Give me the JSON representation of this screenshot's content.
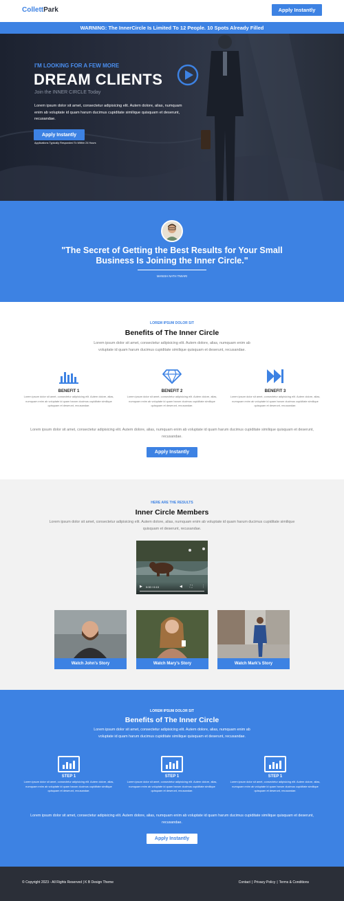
{
  "header": {
    "logo_part1": "Collett",
    "logo_part2": "Park",
    "cta_label": "Apply Instantly"
  },
  "warning_bar": {
    "text": "WARNING: The InnerCircle Is Limited To 12 People. 10 Spots Already Filled"
  },
  "hero": {
    "pretitle": "I'M LOOKING FOR A FEW MORE",
    "title": "DREAM CLIENTS",
    "subtitle": "Join the INNER CIRCLE Today",
    "body": "Lorem ipsum dolor sit amet, consectetur adipisicing elit. Autem dolore, alias, numquam enim ab voluptate id quam harum ducimus cupiditate similique quisquam et deserunt, recusandae.",
    "cta_label": "Apply Instantly",
    "note": "Applications Typically Responded To Within 24 Hours"
  },
  "testimonial": {
    "quote": "\"The Secret of Getting the Best Results for Your Small Business Is Joining the Inner Circle.\"",
    "author": "MANISH NATH TIWARI"
  },
  "benefits": {
    "eyebrow": "LOREM IPSUM DOLOR SIT",
    "title": "Benefits of The Inner Circle",
    "description": "Lorem ipsum dolor sit amet, consectetur adipisicing elit. Autem dolore, alias, numquam enim ab voluptate id quam harum ducimus cupiditate similique quisquam et deserunt, recusandae.",
    "items": [
      {
        "icon": "bar-chart-icon",
        "title": "BENEFIT 1",
        "text": "Lorem ipsum dolor sit amet, consectetur adipisicing elit. Autem dolore, alias, numquam enim ab voluptate id quam harum ducimus cupiditate similique quisquam et deserunt, recusandae."
      },
      {
        "icon": "diamond-icon",
        "title": "BENEFIT 2",
        "text": "Lorem ipsum dolor sit amet, consectetur adipisicing elit. Autem dolore, alias, numquam enim ab voluptate id quam harum ducimus cupiditate similique quisquam et deserunt, recusandae."
      },
      {
        "icon": "fast-forward-icon",
        "title": "BENEFIT 3",
        "text": "Lorem ipsum dolor sit amet, consectetur adipisicing elit. Autem dolore, alias, numquam enim ab voluptate id quam harum ducimus cupiditate similique quisquam et deserunt, recusandae."
      }
    ],
    "footer_text": "Lorem ipsum dolor sit amet, consectetur adipisicing elit. Autem dolore, alias, numquam enim ab voluptate id quam harum ducimus cupiditate similique quisquam et deserunt, recusandae.",
    "cta_label": "Apply Instantly"
  },
  "members": {
    "eyebrow": "HERE ARE THE RESULTS",
    "title": "Inner Circle Members",
    "description": "Lorem ipsum dolor sit amet, consectetur adipisicing elit. Autem dolore, alias, numquam enim ab voluptate id quam harum ducimus cupiditate similique quisquam et deserunt, recusandae.",
    "video": {
      "time": "0:00 / 0:13"
    },
    "stories": [
      {
        "label": "Watch John's Story"
      },
      {
        "label": "Watch Mary's Story"
      },
      {
        "label": "Watch Mark's Story"
      }
    ]
  },
  "steps": {
    "eyebrow": "LOREM IPSUM DOLOR SIT",
    "title": "Benefits of The Inner Circle",
    "description": "Lorem ipsum dolor sit amet, consectetur adipisicing elit. Autem dolore, alias, numquam enim ab voluptate id quam harum ducimus cupiditate similique quisquam et deserunt, recusandae.",
    "items": [
      {
        "title": "STEP 1",
        "text": "Lorem ipsum dolor sit amet, consectetur adipisicing elit. Autem dolore, alias, numquam enim ab voluptate id quam harum ducimus cupiditate similique quisquam et deserunt, recusandae."
      },
      {
        "title": "STEP 1",
        "text": "Lorem ipsum dolor sit amet, consectetur adipisicing elit. Autem dolore, alias, numquam enim ab voluptate id quam harum ducimus cupiditate similique quisquam et deserunt, recusandae."
      },
      {
        "title": "STEP 1",
        "text": "Lorem ipsum dolor sit amet, consectetur adipisicing elit. Autem dolore, alias, numquam enim ab voluptate id quam harum ducimus cupiditate similique quisquam et deserunt, recusandae."
      }
    ],
    "footer_text": "Lorem ipsum dolor sit amet, consectetur adipisicing elit. Autem dolore, alias, numquam enim ab voluptate id quam harum ducimus cupiditate similique quisquam et deserunt, recusandae.",
    "cta_label": "Apply Instantly"
  },
  "footer": {
    "copyright": "© Copyright 2023 - All Rights Reserved | K B Design Theme",
    "links": [
      "Contact",
      "Privacy Policy",
      "Terms & Conditions"
    ],
    "separator": "|"
  },
  "colors": {
    "accent": "#3d82e3",
    "dark": "#2b2f38",
    "light_bg": "#f2f2f2"
  }
}
